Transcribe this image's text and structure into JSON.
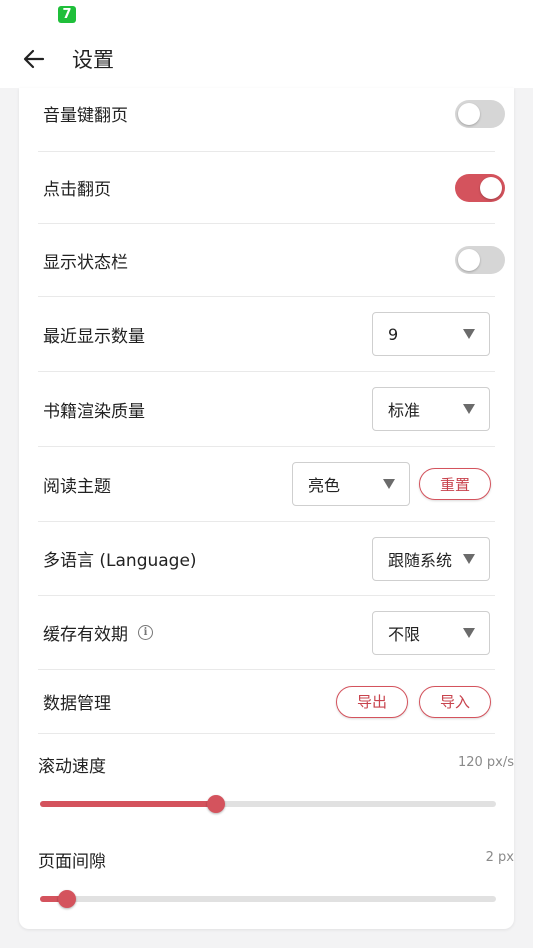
{
  "status_bar": {
    "app_badge": "7"
  },
  "app_bar": {
    "title": "设置"
  },
  "settings": {
    "volume_key_page": {
      "label": "音量键翻页",
      "enabled": false
    },
    "tap_page": {
      "label": "点击翻页",
      "enabled": true
    },
    "show_status_bar": {
      "label": "显示状态栏",
      "enabled": false
    },
    "recent_count": {
      "label": "最近显示数量",
      "value": "9"
    },
    "render_quality": {
      "label": "书籍渲染质量",
      "value": "标准"
    },
    "reading_theme": {
      "label": "阅读主题",
      "value": "亮色",
      "reset_label": "重置"
    },
    "language": {
      "label": "多语言 (Language)",
      "value": "跟随系统"
    },
    "cache_expiry": {
      "label": "缓存有效期",
      "value": "不限"
    },
    "data_management": {
      "label": "数据管理",
      "export_label": "导出",
      "import_label": "导入"
    }
  },
  "sliders": {
    "scroll_speed": {
      "label": "滚动速度",
      "value_text": "120 px/s",
      "fraction": 0.386
    },
    "page_gap": {
      "label": "页面间隙",
      "value_text": "2 px",
      "fraction": 0.06
    }
  },
  "colors": {
    "accent": "#d4535d",
    "toggle_off": "#d6d6d6"
  }
}
